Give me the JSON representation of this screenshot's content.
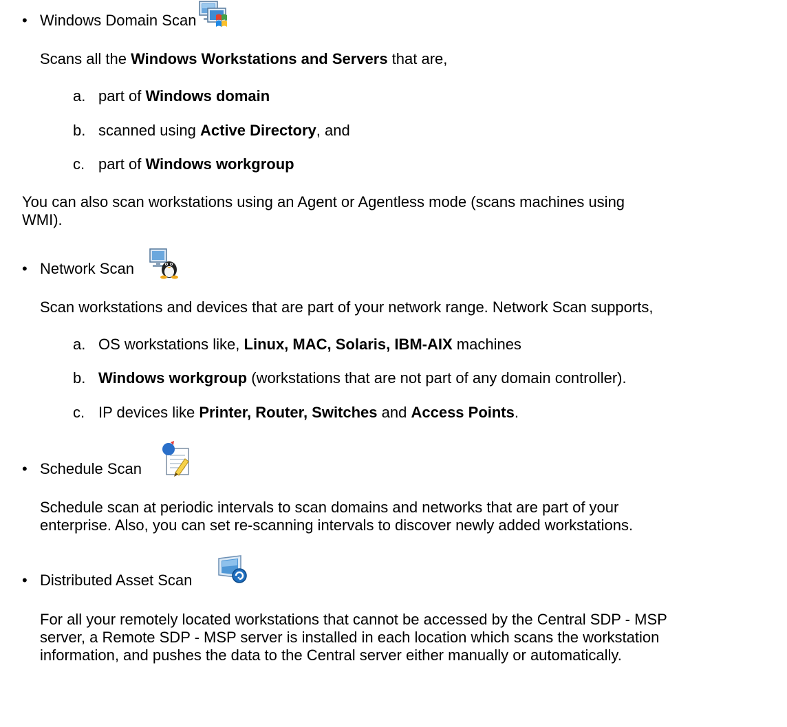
{
  "sections": [
    {
      "title": "Windows Domain Scan",
      "icon": "windows-domain-scan-icon",
      "intro": [
        {
          "t": "Scans all the "
        },
        {
          "t": "Windows Workstations and Servers",
          "b": true
        },
        {
          "t": " that are,"
        }
      ],
      "items": [
        {
          "marker": "a.",
          "parts": [
            {
              "t": "part of "
            },
            {
              "t": "Windows domain",
              "b": true
            }
          ]
        },
        {
          "marker": "b.",
          "parts": [
            {
              "t": "scanned using "
            },
            {
              "t": "Active Directory",
              "b": true
            },
            {
              "t": ", and"
            }
          ]
        },
        {
          "marker": "c.",
          "parts": [
            {
              "t": "part of "
            },
            {
              "t": "Windows workgroup",
              "b": true
            }
          ]
        }
      ],
      "note_lines": [
        " You can also scan workstations using an Agent or Agentless mode (scans machines using",
        "WMI)."
      ]
    },
    {
      "title": "Network Scan",
      "icon": "network-scan-icon",
      "intro": [
        {
          "t": "Scan workstations and devices that are part of your network range. Network Scan supports,"
        }
      ],
      "items": [
        {
          "marker": "a.",
          "parts": [
            {
              "t": "OS workstations like, "
            },
            {
              "t": "Linux, MAC, Solaris, IBM-AIX",
              "b": true
            },
            {
              "t": " machines"
            }
          ]
        },
        {
          "marker": "b.",
          "parts": [
            {
              "t": "Windows workgroup",
              "b": true
            },
            {
              "t": " (workstations that are not part of any domain controller)."
            }
          ]
        },
        {
          "marker": "c.",
          "parts": [
            {
              "t": "IP devices like "
            },
            {
              "t": "Printer, Router, Switches",
              "b": true
            },
            {
              "t": " and "
            },
            {
              "t": "Access Points",
              "b": true
            },
            {
              "t": "."
            }
          ]
        }
      ]
    },
    {
      "title": "Schedule Scan",
      "icon": "schedule-scan-icon",
      "body_lines": [
        "Schedule scan at periodic intervals to scan domains and networks that are part of your",
        "enterprise. Also, you can set re-scanning intervals to  discover newly added workstations."
      ]
    },
    {
      "title": "Distributed Asset Scan",
      "icon": "distributed-asset-scan-icon",
      "body_lines": [
        "For all your remotely located workstations that cannot be accessed by the Central SDP - MSP",
        "server, a Remote SDP - MSP server is installed in each location which scans the workstation",
        "information, and pushes the data to the Central server either manually or automatically."
      ]
    }
  ],
  "colors": {
    "text": "#000000",
    "background": "#ffffff",
    "icon_blue": "#2a6fc9",
    "icon_green": "#3f9a3a"
  }
}
